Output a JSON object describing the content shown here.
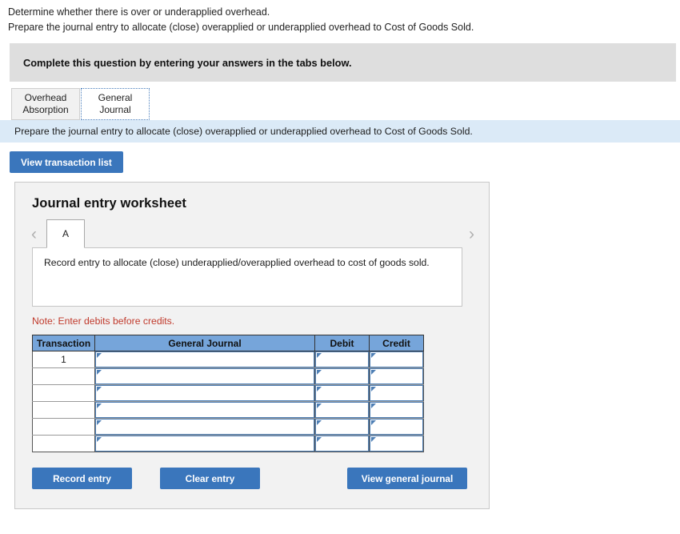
{
  "intro": {
    "line1": "Determine whether there is over or underapplied overhead.",
    "line2": "Prepare the journal entry to allocate (close) overapplied or underapplied overhead to Cost of Goods Sold."
  },
  "banner": {
    "text": "Complete this question by entering your answers in the tabs below."
  },
  "tabs": [
    {
      "label_line1": "Overhead",
      "label_line2": "Absorption",
      "active": false
    },
    {
      "label_line1": "General",
      "label_line2": "Journal",
      "active": true
    }
  ],
  "infobar": {
    "text": "Prepare the journal entry to allocate (close) overapplied or underapplied overhead to Cost of Goods Sold."
  },
  "toolbar": {
    "view_transaction_list_label": "View transaction list"
  },
  "worksheet": {
    "title": "Journal entry worksheet",
    "pager": {
      "prev_icon": "chevron-left-icon",
      "next_icon": "chevron-right-icon",
      "entries": [
        "A"
      ],
      "selected_entry": "A"
    },
    "description": "Record entry to allocate (close) underapplied/overapplied overhead to cost of goods sold.",
    "note": "Note: Enter debits before credits.",
    "table": {
      "headers": [
        "Transaction",
        "General Journal",
        "Debit",
        "Credit"
      ],
      "rows": [
        {
          "transaction": "1",
          "general_journal": "",
          "debit": "",
          "credit": ""
        },
        {
          "transaction": "",
          "general_journal": "",
          "debit": "",
          "credit": ""
        },
        {
          "transaction": "",
          "general_journal": "",
          "debit": "",
          "credit": ""
        },
        {
          "transaction": "",
          "general_journal": "",
          "debit": "",
          "credit": ""
        },
        {
          "transaction": "",
          "general_journal": "",
          "debit": "",
          "credit": ""
        },
        {
          "transaction": "",
          "general_journal": "",
          "debit": "",
          "credit": ""
        }
      ]
    },
    "buttons": {
      "record_entry": "Record entry",
      "clear_entry": "Clear entry",
      "view_general_journal": "View general journal"
    }
  },
  "colors": {
    "accent_blue": "#3a76bc",
    "table_header_blue": "#76a5da",
    "infobar_blue": "#dbeaf7",
    "banner_gray": "#dedede",
    "panel_gray": "#f2f2f2",
    "note_red": "#c0392b"
  }
}
